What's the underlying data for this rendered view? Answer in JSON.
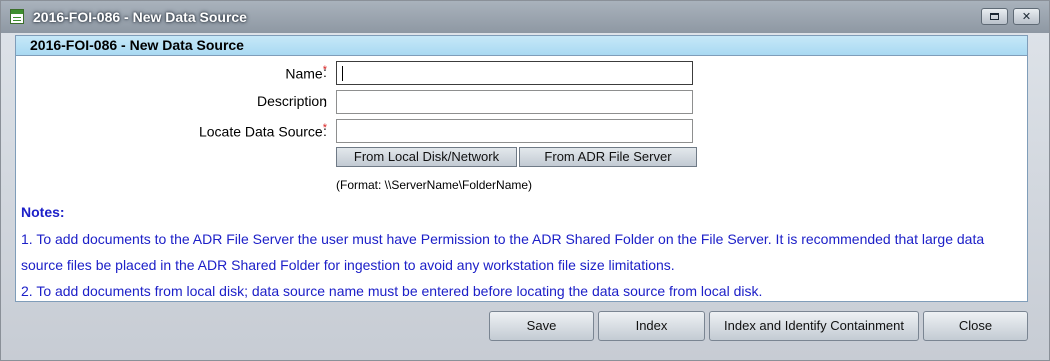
{
  "window": {
    "title": "2016-FOI-086 - New Data Source",
    "maximize_icon": "maximize-icon",
    "close_glyph": "✕"
  },
  "panel": {
    "title": "2016-FOI-086 - New Data Source"
  },
  "form": {
    "name": {
      "label": "Name",
      "required": "*",
      "colon": ":",
      "value": ""
    },
    "description": {
      "label": "Description",
      "colon": ":",
      "value": ""
    },
    "locate": {
      "label": "Locate Data Source",
      "required": "*",
      "colon": ":",
      "value": ""
    },
    "from_local_label": "From Local Disk/Network",
    "from_server_label": "From ADR File Server",
    "format_hint": "(Format: \\\\ServerName\\FolderName)"
  },
  "notes": {
    "title": "Notes:",
    "items": [
      "1. To add documents to the ADR File Server the user must have Permission to the ADR Shared Folder on the File Server. It is recommended that large data source files be placed in the ADR Shared Folder for ingestion to avoid any workstation file size limitations.",
      "2. To add documents from local disk; data source name must be entered before locating the data source from local disk."
    ]
  },
  "actions": {
    "save": "Save",
    "index": "Index",
    "index_identify": "Index and Identify Containment",
    "close": "Close"
  }
}
